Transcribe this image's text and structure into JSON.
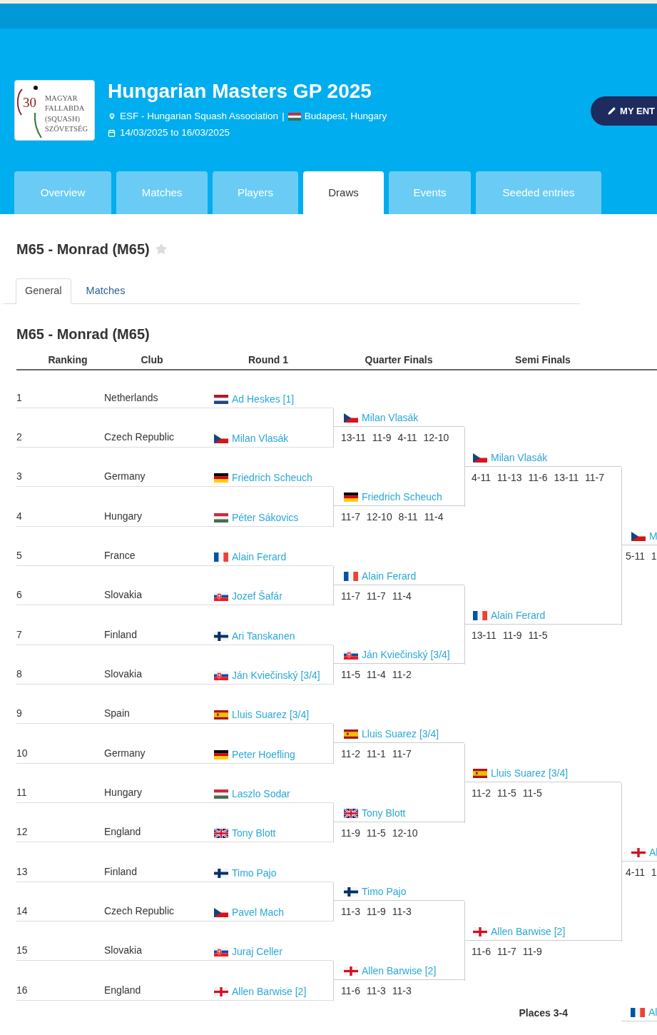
{
  "header": {
    "logo": {
      "number": "30",
      "lines": [
        "MAGYAR",
        "FALLABDA",
        "(SQUASH)",
        "SZÖVETSÉG"
      ]
    },
    "title": "Hungarian Masters GP 2025",
    "organizer": "ESF - Hungarian Squash Association",
    "separator": "|",
    "place": {
      "kind": "hungary",
      "text": "Budapest, Hungary"
    },
    "dates": "14/03/2025 to 16/03/2025",
    "entry_button": "MY ENT"
  },
  "tabs": [
    {
      "label": "Overview",
      "selected": false
    },
    {
      "label": "Matches",
      "selected": false
    },
    {
      "label": "Players",
      "selected": false
    },
    {
      "label": "Draws",
      "selected": true
    },
    {
      "label": "Events",
      "selected": false
    },
    {
      "label": "Seeded entries",
      "selected": false
    }
  ],
  "draw": {
    "title": "M65 - Monrad (M65)",
    "favorite": false,
    "subtabs": [
      {
        "label": "General",
        "selected": true
      },
      {
        "label": "Matches",
        "selected": false
      }
    ],
    "heading": "M65 - Monrad (M65)",
    "columns": [
      "Ranking",
      "Club",
      "Round 1",
      "Quarter Finals",
      "Semi Finals"
    ],
    "entries": [
      {
        "ranking": "1",
        "club": "Netherlands",
        "player": "Ad Heskes [1]",
        "kind": "netherlands"
      },
      {
        "ranking": "2",
        "club": "Czech Republic",
        "player": "Milan Vlasák",
        "kind": "czechia"
      },
      {
        "ranking": "3",
        "club": "Germany",
        "player": "Friedrich Scheuch",
        "kind": "germany"
      },
      {
        "ranking": "4",
        "club": "Hungary",
        "player": "Péter Sákovics",
        "kind": "hungary"
      },
      {
        "ranking": "5",
        "club": "France",
        "player": "Alain Ferard",
        "kind": "france"
      },
      {
        "ranking": "6",
        "club": "Slovakia",
        "player": "Jozef Šafár",
        "kind": "slovakia"
      },
      {
        "ranking": "7",
        "club": "Finland",
        "player": "Ari Tanskanen",
        "kind": "finland"
      },
      {
        "ranking": "8",
        "club": "Slovakia",
        "player": "Ján Kviečinský [3/4]",
        "kind": "slovakia"
      },
      {
        "ranking": "9",
        "club": "Spain",
        "player": "Lluis Suarez [3/4]",
        "kind": "spain"
      },
      {
        "ranking": "10",
        "club": "Germany",
        "player": "Peter Hoefling",
        "kind": "germany"
      },
      {
        "ranking": "11",
        "club": "Hungary",
        "player": "Laszlo Sodar",
        "kind": "hungary"
      },
      {
        "ranking": "12",
        "club": "England",
        "player": "Tony Blott",
        "kind": "britain"
      },
      {
        "ranking": "13",
        "club": "Finland",
        "player": "Timo Pajo",
        "kind": "finland"
      },
      {
        "ranking": "14",
        "club": "Czech Republic",
        "player": "Pavel Mach",
        "kind": "czechia"
      },
      {
        "ranking": "15",
        "club": "Slovakia",
        "player": "Juraj Celler",
        "kind": "slovakia"
      },
      {
        "ranking": "16",
        "club": "England",
        "player": "Allen Barwise [2]",
        "kind": "england"
      }
    ],
    "rounds": [
      {
        "matches": [
          {
            "player": "Milan Vlasák",
            "kind": "czechia",
            "score": "13-11 11-9 4-11 12-10"
          },
          {
            "player": "Friedrich Scheuch",
            "kind": "germany",
            "score": "11-7 12-10 8-11 11-4"
          },
          {
            "player": "Alain Ferard",
            "kind": "france",
            "score": "11-7 11-7 11-4"
          },
          {
            "player": "Ján Kviečinský [3/4]",
            "kind": "slovakia",
            "score": "11-5 11-4 11-2"
          },
          {
            "player": "Lluis Suarez [3/4]",
            "kind": "spain",
            "score": "11-2 11-1 11-7"
          },
          {
            "player": "Tony Blott",
            "kind": "britain",
            "score": "11-9 11-5 12-10"
          },
          {
            "player": "Timo Pajo",
            "kind": "finland",
            "score": "11-3 11-9 11-3"
          },
          {
            "player": "Allen Barwise [2]",
            "kind": "england",
            "score": "11-6 11-3 11-3"
          }
        ]
      },
      {
        "matches": [
          {
            "player": "Milan Vlasák",
            "kind": "czechia",
            "score": "4-11 11-13 11-6 13-11 11-7"
          },
          {
            "player": "Alain Ferard",
            "kind": "france",
            "score": "13-11 11-9 11-5"
          },
          {
            "player": "Lluis Suarez [3/4]",
            "kind": "spain",
            "score": "11-2 11-5 11-5"
          },
          {
            "player": "Allen Barwise [2]",
            "kind": "england",
            "score": "11-6 11-7 11-9"
          }
        ]
      },
      {
        "matches": [
          {
            "player": "M",
            "kind": "czechia",
            "score": "5-11 1"
          },
          {
            "player": "Al",
            "kind": "england",
            "score": "4-11 1"
          }
        ]
      }
    ],
    "places_label": "Places 3-4",
    "places_match": {
      "player": "Al",
      "kind": "france"
    }
  }
}
